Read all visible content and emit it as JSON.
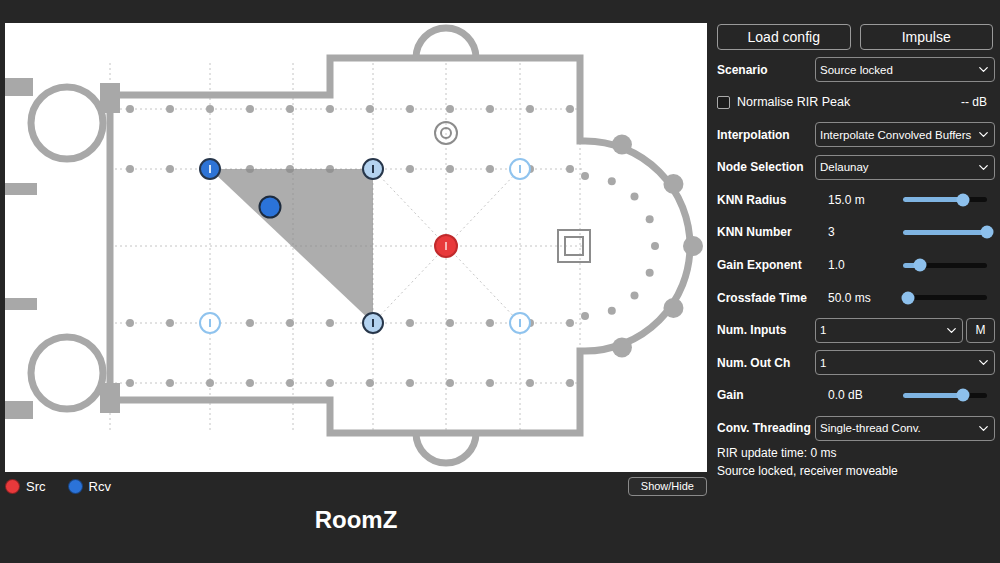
{
  "canvas": {
    "ir_nodes": [
      {
        "active": true,
        "nearest": true
      },
      {
        "active": true,
        "nearest": false
      },
      {
        "active": false,
        "nearest": false
      },
      {
        "active": false,
        "nearest": false
      },
      {
        "active": true,
        "nearest": false
      },
      {
        "active": false,
        "nearest": false
      }
    ]
  },
  "legend": [
    {
      "label": "Src",
      "color": "#e8393b"
    },
    {
      "label": "Rcv",
      "color": "#2b73d9"
    }
  ],
  "show_hide_button": "Show/Hide",
  "title": "RoomZ",
  "buttons": [
    "Load config",
    "Impulse"
  ],
  "controls": [
    {
      "kind": "select",
      "label": "Scenario",
      "value": "Source locked"
    },
    {
      "kind": "checkbox",
      "label": "Normalise RIR Peak",
      "checked": false,
      "reading": "-- dB"
    },
    {
      "kind": "select",
      "label": "Interpolation",
      "value": "Interpolate Convolved Buffers"
    },
    {
      "kind": "select",
      "label": "Node Selection",
      "value": "Delaunay"
    },
    {
      "kind": "slider",
      "label": "KNN Radius",
      "reading": "15.0 m",
      "level": 0.72
    },
    {
      "kind": "slider",
      "label": "KNN Number",
      "reading": "3",
      "level": 1.0
    },
    {
      "kind": "slider",
      "label": "Gain Exponent",
      "reading": "1.0",
      "level": 0.2
    },
    {
      "kind": "slider",
      "label": "Crossfade Time",
      "reading": "50.0 ms",
      "level": 0.06
    },
    {
      "kind": "select",
      "label": "Num. Inputs",
      "value": "1",
      "button": "M"
    },
    {
      "kind": "select",
      "label": "Num. Out Ch",
      "value": "1"
    },
    {
      "kind": "slider",
      "label": "Gain",
      "reading": "0.0 dB",
      "level": 0.72
    },
    {
      "kind": "select",
      "label": "Conv. Threading",
      "value": "Single-thread Conv."
    }
  ],
  "status": [
    "RIR update time: 0 ms",
    "Source locked, receiver moveable"
  ]
}
